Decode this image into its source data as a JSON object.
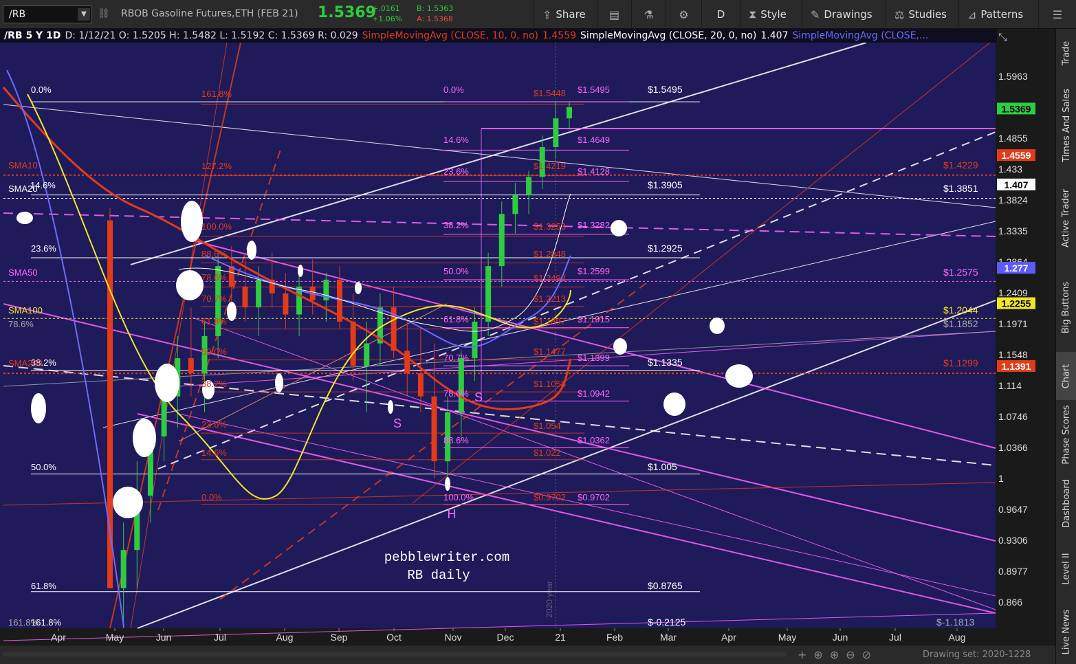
{
  "toolbar": {
    "symbol": "/RB",
    "description": "RBOB Gasoline Futures,ETH (FEB 21)",
    "last": "1.5369",
    "change": "+.0161",
    "change_pct": "+1.06%",
    "bid": "B: 1.5363",
    "ask": "A: 1.5368",
    "buttons": [
      {
        "label": "Share",
        "icon": "share-icon"
      },
      {
        "label": "",
        "icon": "notes-icon"
      },
      {
        "label": "",
        "icon": "flask-icon"
      },
      {
        "label": "",
        "icon": "gear-icon"
      },
      {
        "label": "D",
        "icon": ""
      },
      {
        "label": "Style",
        "icon": "candle-icon"
      },
      {
        "label": "Drawings",
        "icon": "pencil-icon"
      },
      {
        "label": "Studies",
        "icon": "studies-icon"
      },
      {
        "label": "Patterns",
        "icon": "patterns-icon"
      },
      {
        "label": "",
        "icon": "menu-icon"
      }
    ]
  },
  "study_strip": {
    "symbol": "/RB 5 Y 1D",
    "ohlc": "D: 1/12/21  O: 1.5205  H: 1.5482  L: 1.5192  C: 1.5369  R: 0.029",
    "study1": "SimpleMovingAvg (CLOSE, 10, 0, no)",
    "study1_value": "1.4559",
    "study2": "SimpleMovingAvg (CLOSE, 20, 0, no)",
    "study2_value": "1.407",
    "study3": "SimpleMovingAvg (CLOSE,..."
  },
  "side_tabs": [
    "Trade",
    "Times And Sales",
    "Active Trader",
    "Big Buttons",
    "Chart",
    "Phase Scores",
    "Dashboard",
    "Level II",
    "Live News"
  ],
  "active_side_tab": "Chart",
  "bottom": {
    "drawing_set": "Drawing set: 2020-1228"
  },
  "chart_data": {
    "type": "candlestick",
    "title": "",
    "watermark": [
      "pebblewriter.com",
      "RB daily"
    ],
    "year_label": "2020 year",
    "x_ticks": [
      "Apr",
      "May",
      "Jun",
      "Jul",
      "Aug",
      "Sep",
      "Oct",
      "Nov",
      "Dec",
      "21",
      "Feb",
      "Mar",
      "Apr",
      "May",
      "Jun",
      "Jul",
      "Aug"
    ],
    "y_ticks": [
      1.5963,
      1.4855,
      1.433,
      1.3824,
      1.3335,
      1.2864,
      1.2409,
      1.1971,
      1.1548,
      1.114,
      1.0746,
      1.0366,
      1,
      0.9647,
      0.9306,
      0.8977,
      0.866
    ],
    "y_tick_labels": [
      "1.5963",
      "1.4855",
      "1.433",
      "1.3824",
      "1.3335",
      "1.2864",
      "1.2409",
      "1.1971",
      "1.1548",
      "1.114",
      "1.0746",
      "1.0366",
      "1",
      "0.9647",
      "0.9306",
      "0.8977",
      "0.866"
    ],
    "ylim": [
      0.84,
      1.66
    ],
    "y_scale": "log",
    "price_badges": [
      {
        "value": "1.5369",
        "color": "#2ecc40",
        "text_color": "#000"
      },
      {
        "value": "1.4559",
        "color": "#e23b1a",
        "text_color": "#fff"
      },
      {
        "value": "1.407",
        "color": "#ffffff",
        "text_color": "#000"
      },
      {
        "value": "1.277",
        "color": "#5a5aff",
        "text_color": "#fff"
      },
      {
        "value": "1.2255",
        "color": "#f0e62a",
        "text_color": "#000"
      },
      {
        "value": "1.1391",
        "color": "#e23b1a",
        "text_color": "#fff"
      }
    ],
    "fib_right_labels": [
      {
        "text": "$1.5495",
        "color": "#ffffff"
      },
      {
        "text": "$1.3905",
        "color": "#ffffff"
      },
      {
        "text": "$1.2925",
        "color": "#ffffff"
      },
      {
        "text": "$1.1335",
        "color": "#ffffff"
      },
      {
        "text": "$1.005",
        "color": "#ffffff"
      },
      {
        "text": "$0.8765",
        "color": "#ffffff"
      },
      {
        "text": "$-0.2125",
        "color": "#ffffff"
      }
    ],
    "fib_left_labels": [
      {
        "text": "0.0%",
        "color": "#ffffff"
      },
      {
        "text": "23.6%",
        "color": "#ffffff"
      },
      {
        "text": "38.2%",
        "color": "#ffffff"
      },
      {
        "text": "50.0%",
        "color": "#ffffff"
      },
      {
        "text": "61.8%",
        "color": "#ffffff"
      },
      {
        "text": "161.8%",
        "color": "#ffffff"
      }
    ],
    "magenta_fib_labels": [
      {
        "pct": "0.0%",
        "price": "$1.5495"
      },
      {
        "pct": "14.6%",
        "price": "$1.4649"
      },
      {
        "pct": "23.6%",
        "price": "$1.4128"
      },
      {
        "pct": "38.2%",
        "price": "$1.3282"
      },
      {
        "pct": "50.0%",
        "price": "$1.2599"
      },
      {
        "pct": "61.8%",
        "price": "$1.1915"
      },
      {
        "pct": "70.7%",
        "price": "$1.1399"
      },
      {
        "pct": "78.6%",
        "price": "$1.0942"
      },
      {
        "pct": "88.6%",
        "price": "$1.0362"
      },
      {
        "pct": "100.0%",
        "price": "$0.9702"
      }
    ],
    "red_fib_labels": [
      "$1.5448",
      "$1.4219",
      "$1.3253",
      "$1.2848",
      "$1.2492",
      "$1.2213",
      "$1.1897",
      "$1.1477",
      "$1.1058",
      "$1.054",
      "$1.022",
      "$0.9702"
    ],
    "red_fib_pcts": [
      "161.8%",
      "127.2%",
      "100.0%",
      "88.6%",
      "78.6%",
      "70.7%",
      "61.8%",
      "50.0%",
      "38.2%",
      "23.6%",
      "14.6%",
      "0.0%"
    ],
    "sma_labels": [
      {
        "text": "SMA10",
        "color": "#e23b1a",
        "value": "$1.4229"
      },
      {
        "text": "SMA20",
        "color": "#ffffff",
        "value": "$1.3851"
      },
      {
        "text": "SMA50",
        "color": "#ff66ff",
        "value": "$1.2575"
      },
      {
        "text": "SMA100",
        "color": "#f0e62a",
        "value": "$1.2044"
      },
      {
        "text": "SMA200",
        "color": "#e23b1a",
        "value": "$1.1299"
      }
    ],
    "other_right_labels": [
      {
        "text": "$1.1852",
        "color": "#aaaaaa"
      },
      {
        "text": "$-1.1813",
        "color": "#aaaaaa"
      }
    ],
    "left_misc_labels": [
      {
        "text": "14.6%",
        "color": "#ffffff"
      },
      {
        "text": "78.6%",
        "color": "#aaaaaa"
      },
      {
        "text": "161.8%",
        "color": "#aaaaaa"
      }
    ],
    "pattern_labels": [
      "S",
      "S",
      "H"
    ],
    "candles": [
      [
        1.35,
        1.37,
        1.06,
        0.88
      ],
      [
        0.88,
        0.95,
        0.84,
        0.92
      ],
      [
        0.92,
        1.02,
        0.88,
        0.98
      ],
      [
        0.98,
        1.06,
        0.95,
        1.05
      ],
      [
        1.05,
        1.12,
        1.02,
        1.1
      ],
      [
        1.1,
        1.18,
        1.06,
        1.15
      ],
      [
        1.15,
        1.22,
        1.1,
        1.13
      ],
      [
        1.13,
        1.2,
        1.08,
        1.18
      ],
      [
        1.18,
        1.3,
        1.15,
        1.28
      ],
      [
        1.28,
        1.31,
        1.22,
        1.25
      ],
      [
        1.25,
        1.29,
        1.2,
        1.22
      ],
      [
        1.22,
        1.28,
        1.18,
        1.26
      ],
      [
        1.26,
        1.3,
        1.22,
        1.24
      ],
      [
        1.24,
        1.27,
        1.19,
        1.21
      ],
      [
        1.21,
        1.28,
        1.18,
        1.25
      ],
      [
        1.25,
        1.29,
        1.21,
        1.23
      ],
      [
        1.23,
        1.27,
        1.2,
        1.26
      ],
      [
        1.26,
        1.28,
        1.19,
        1.2
      ],
      [
        1.2,
        1.24,
        1.12,
        1.14
      ],
      [
        1.14,
        1.2,
        1.08,
        1.17
      ],
      [
        1.17,
        1.24,
        1.14,
        1.22
      ],
      [
        1.22,
        1.25,
        1.15,
        1.16
      ],
      [
        1.16,
        1.2,
        1.1,
        1.13
      ],
      [
        1.13,
        1.19,
        1.08,
        1.1
      ],
      [
        1.1,
        1.17,
        1.0,
        1.02
      ],
      [
        1.02,
        1.1,
        0.99,
        1.08
      ],
      [
        1.08,
        1.16,
        1.05,
        1.15
      ],
      [
        1.15,
        1.22,
        1.12,
        1.2
      ],
      [
        1.2,
        1.3,
        1.18,
        1.28
      ],
      [
        1.28,
        1.38,
        1.25,
        1.36
      ],
      [
        1.36,
        1.41,
        1.33,
        1.39
      ],
      [
        1.39,
        1.43,
        1.36,
        1.42
      ],
      [
        1.42,
        1.49,
        1.4,
        1.47
      ],
      [
        1.47,
        1.55,
        1.45,
        1.52
      ],
      [
        1.52,
        1.55,
        1.5,
        1.54
      ]
    ]
  }
}
